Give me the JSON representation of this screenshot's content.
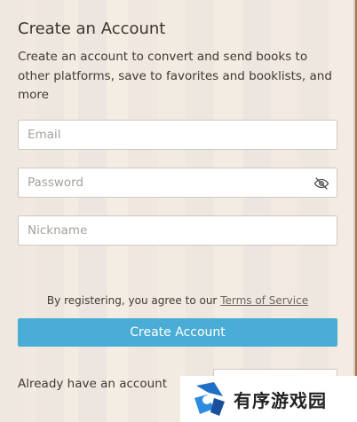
{
  "modal": {
    "title": "Create an Account",
    "description": "Create an account to convert and send books to other platforms, save to favorites and booklists, and more"
  },
  "form": {
    "email_placeholder": "Email",
    "password_placeholder": "Password",
    "nickname_placeholder": "Nickname"
  },
  "terms": {
    "prefix": "By registering, you agree to our ",
    "link": "Terms of Service"
  },
  "submit_label": "Create Account",
  "login_prompt": "Already have an account",
  "watermark": {
    "text": "有序游戏园"
  },
  "colors": {
    "accent": "#49add5"
  },
  "icons": {
    "password_toggle": "eye-slash-icon"
  }
}
